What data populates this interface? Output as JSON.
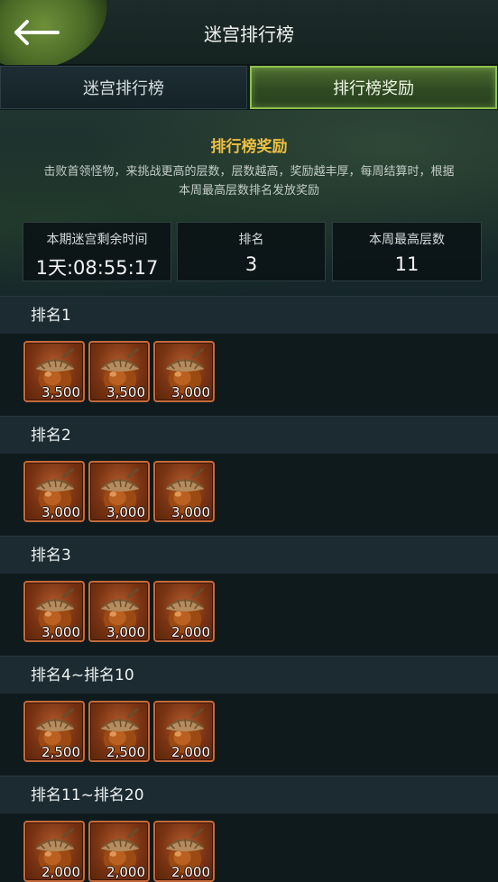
{
  "header": {
    "title": "迷宫排行榜",
    "back_icon": "arrow-left-icon"
  },
  "tabs": [
    {
      "label": "迷宫排行榜",
      "active": false
    },
    {
      "label": "排行榜奖励",
      "active": true
    }
  ],
  "intro": {
    "title": "排行榜奖励",
    "description": "击败首领怪物，来挑战更高的层数，层数越高，奖励越丰厚，每周结算时，根据本周最高层数排名发放奖励"
  },
  "stats": [
    {
      "label": "本期迷宫剩余时间",
      "value": "1天:08:55:17"
    },
    {
      "label": "排名",
      "value": "3"
    },
    {
      "label": "本周最高层数",
      "value": "11"
    }
  ],
  "reward_icon": "acorn-icon",
  "rewards": [
    {
      "rank": "排名1",
      "items": [
        "3,500",
        "3,500",
        "3,000"
      ]
    },
    {
      "rank": "排名2",
      "items": [
        "3,000",
        "3,000",
        "3,000"
      ]
    },
    {
      "rank": "排名3",
      "items": [
        "3,000",
        "3,000",
        "2,000"
      ]
    },
    {
      "rank": "排名4~排名10",
      "items": [
        "2,500",
        "2,500",
        "2,000"
      ]
    },
    {
      "rank": "排名11~排名20",
      "items": [
        "2,000",
        "2,000",
        "2,000"
      ]
    }
  ],
  "colors": {
    "accent_gold": "#ecc041",
    "active_tab_border": "#8fc04a",
    "item_border": "#c56a3a"
  }
}
